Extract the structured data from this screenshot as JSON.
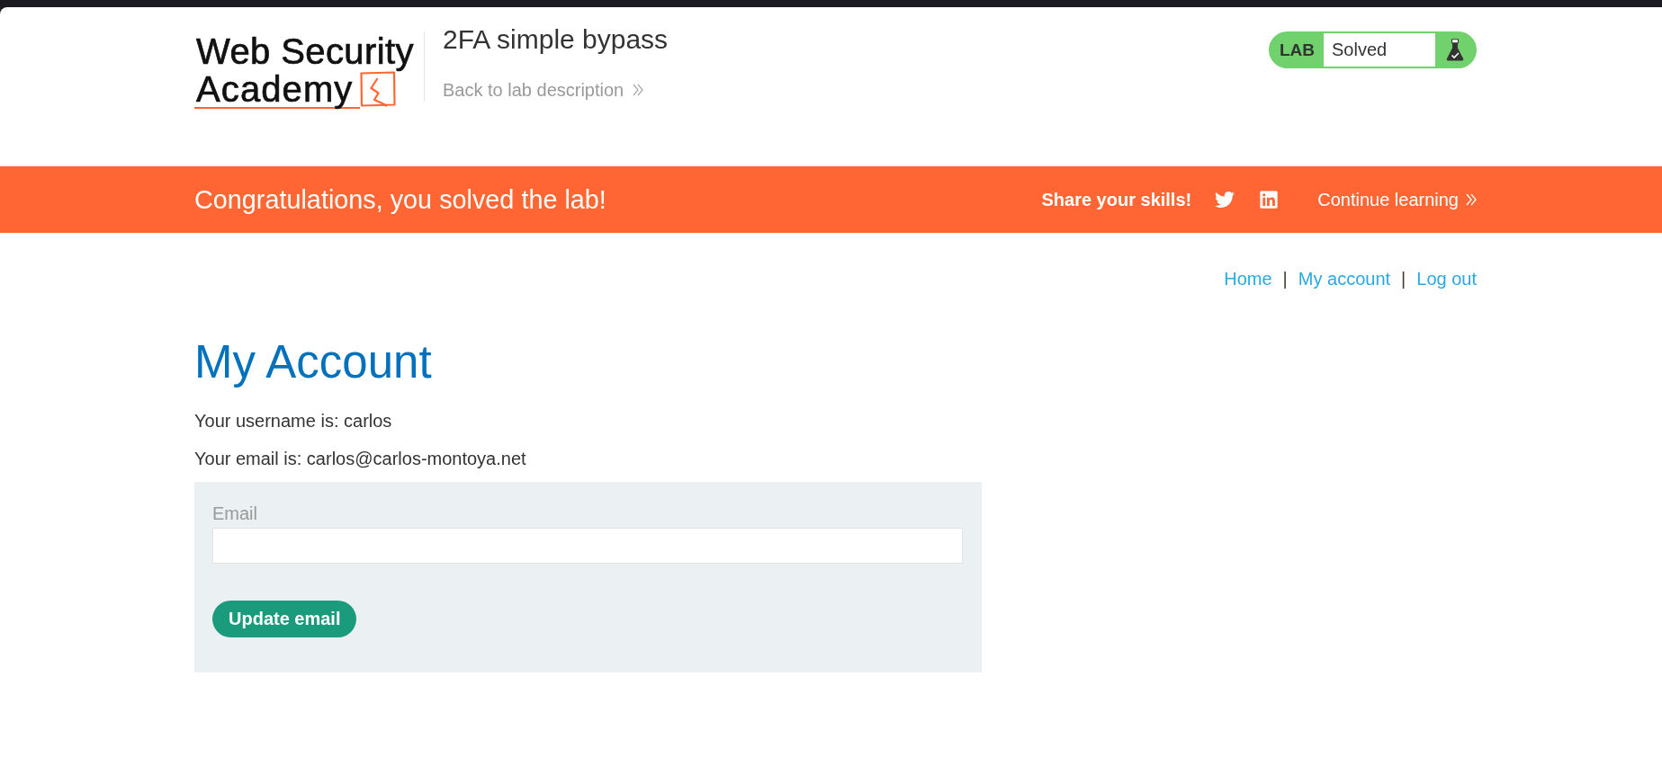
{
  "header": {
    "logo": {
      "lines": [
        "Web Security",
        "Academy"
      ]
    },
    "lab_title": "2FA simple bypass",
    "back_link": "Back to lab description",
    "lab_status": {
      "label": "LAB",
      "status": "Solved",
      "solved": true
    }
  },
  "banner": {
    "message": "Congratulations, you solved the lab!",
    "share_label": "Share your skills!",
    "continue_link": "Continue learning"
  },
  "nav": {
    "links": [
      {
        "label": "Home"
      },
      {
        "label": "My account"
      },
      {
        "label": "Log out"
      }
    ],
    "separator": "|"
  },
  "account": {
    "heading": "My Account",
    "details": [
      "Your username is: carlos",
      "Your email is: carlos@carlos-montoya.net"
    ],
    "form": {
      "field_label": "Email",
      "button": "Update email"
    }
  }
}
